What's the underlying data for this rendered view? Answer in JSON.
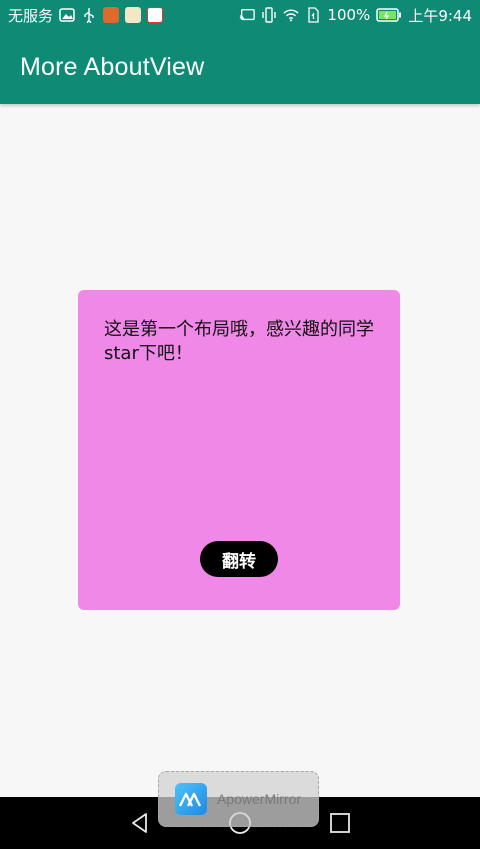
{
  "status_bar": {
    "carrier": "无服务",
    "battery": "100%",
    "time": "上午9:44",
    "icons": [
      "gallery-icon",
      "usb-icon",
      "app-icon",
      "maps-icon",
      "weibo-icon",
      "cast-icon",
      "vibrate-icon",
      "wifi-icon",
      "sim-icon",
      "battery-icon"
    ]
  },
  "app_bar": {
    "title": "More AboutView",
    "background_color": "#0f8a75"
  },
  "card": {
    "text": "这是第一个布局哦，感兴趣的同学star下吧！",
    "button_label": "翻转",
    "background_color": "#ef88e6"
  },
  "overlay": {
    "label": "ApowerMirror"
  },
  "nav_bar": {
    "buttons": [
      "back-icon",
      "home-icon",
      "recents-icon"
    ]
  }
}
